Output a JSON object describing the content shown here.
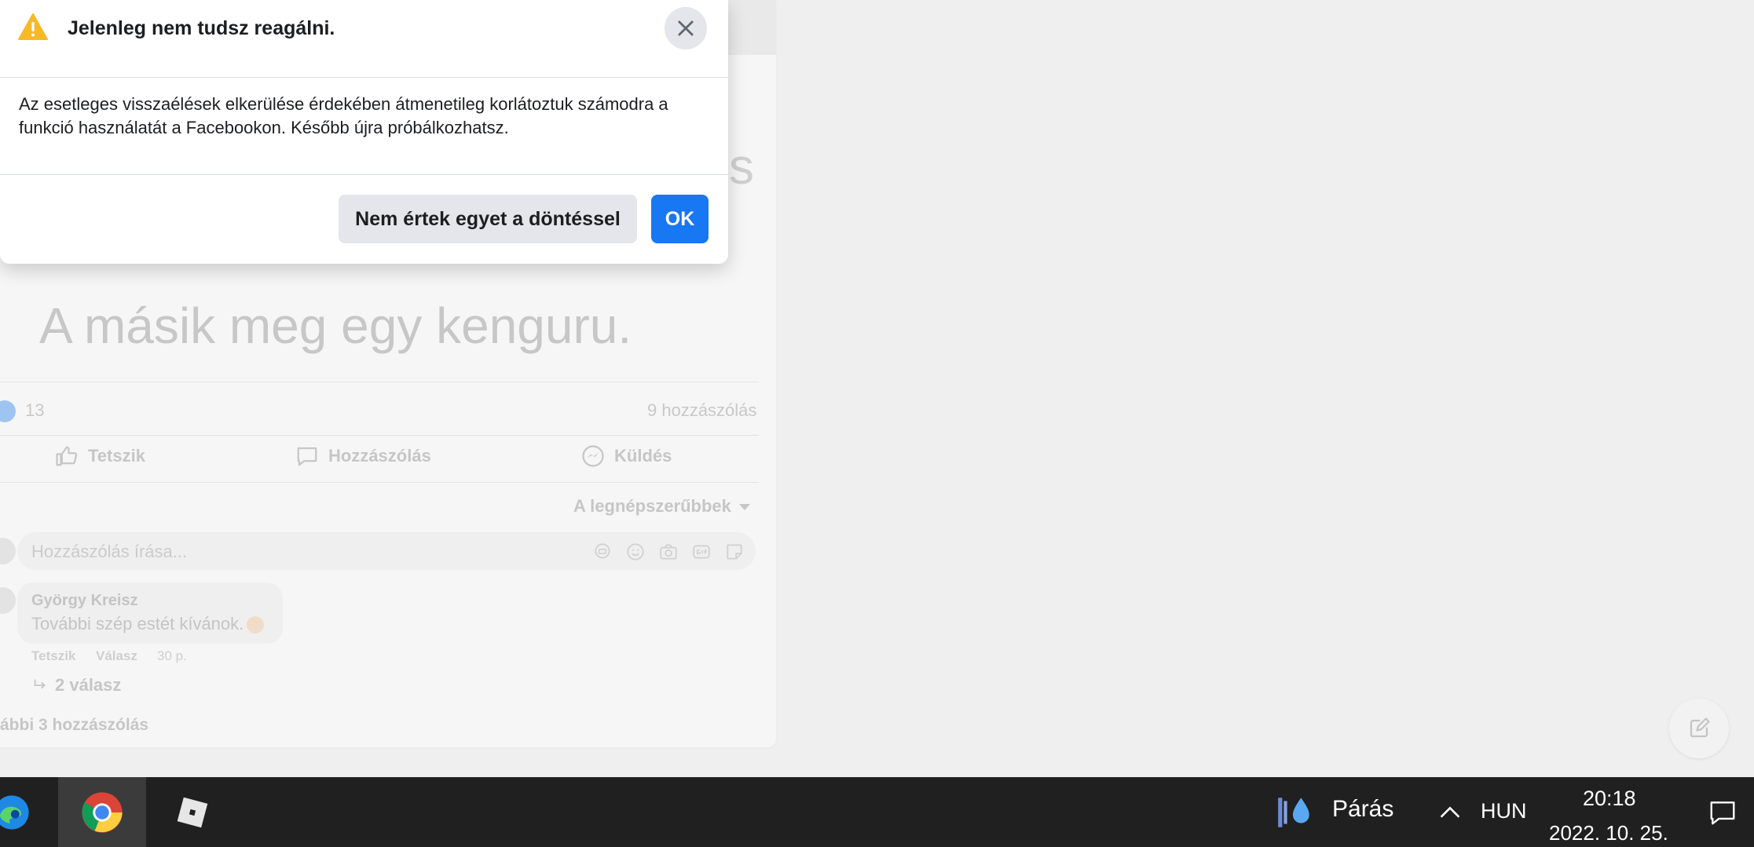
{
  "dialog": {
    "title": "Jelenleg nem tudsz reagálni.",
    "body": "Az esetleges visszaélések elkerülése érdekében átmenetileg korlátoztuk számodra a funkció használatát a Facebookon. Később újra próbálkozhatsz.",
    "disagree_label": "Nem értek egyet a döntéssel",
    "ok_label": "OK"
  },
  "post": {
    "title_fragment": "s",
    "big_text": "A másik meg egy kenguru.",
    "reaction_count": "13",
    "comment_count": "9 hozzászólás",
    "actions": {
      "like": "Tetszik",
      "comment": "Hozzászólás",
      "send": "Küldés"
    },
    "sort_label": "A legnépszerűbbek",
    "comment_placeholder": "Hozzászólás írása...",
    "comment": {
      "author": "György Kreisz",
      "text": "További szép estét kívánok.",
      "like": "Tetszik",
      "reply": "Válasz",
      "time": "30 p.",
      "replies": "2 válasz"
    },
    "more_comments": "ábbi 3 hozzászólás"
  },
  "taskbar": {
    "weather": "Párás",
    "language": "HUN",
    "time": "20:18",
    "date": "2022. 10. 25."
  }
}
